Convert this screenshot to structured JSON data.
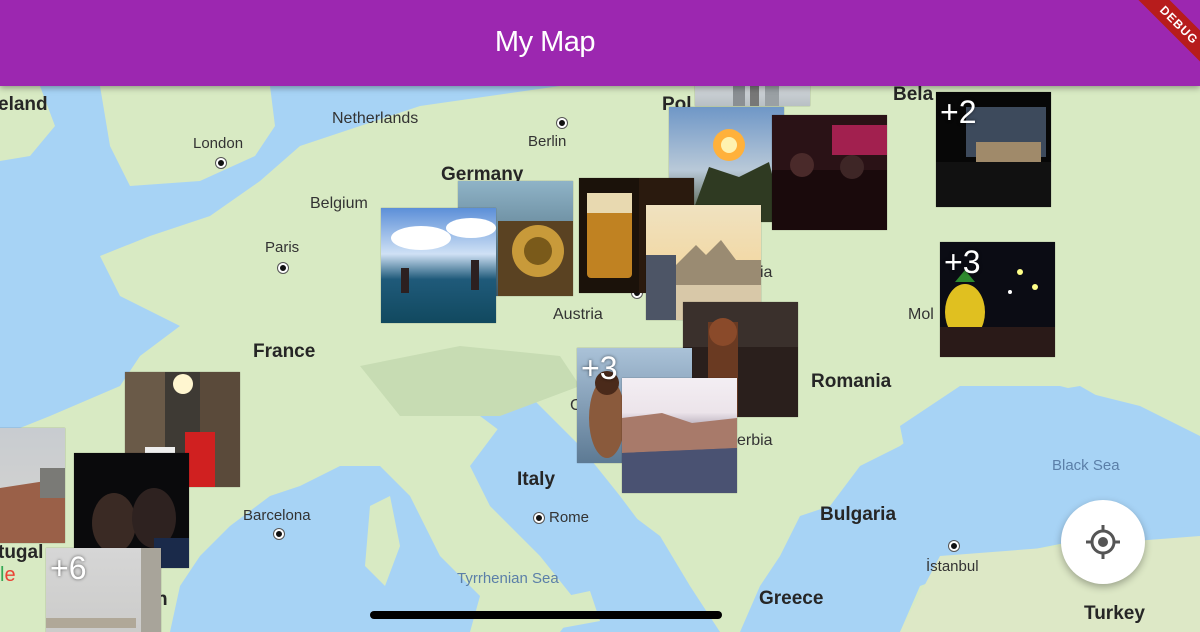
{
  "app": {
    "title": "My Map",
    "debug_banner": "DEBUG"
  },
  "map": {
    "countries": [
      "Ireland",
      "Netherlands",
      "Germany",
      "Belgium",
      "France",
      "Austria",
      "Poland",
      "Belarus",
      "Moldova",
      "Romania",
      "Serbia",
      "Italy",
      "Bulgaria",
      "Greece",
      "Turkey",
      "Portugal",
      "Croatia"
    ],
    "country_labels": {
      "ireland": "eland",
      "netherlands": "Netherlands",
      "germany": "Germany",
      "belgium": "Belgium",
      "france": "France",
      "austria": "Austria",
      "poland": "Pol",
      "belarus": "Bela",
      "moldova": "Mol",
      "romania": "Romania",
      "serbia": "erbia",
      "italy": "Italy",
      "bulgaria": "Bulgaria",
      "greece": "Greece",
      "turkey": "Turkey",
      "portugal": "tugal",
      "croatia": "C",
      "slovakia": "ia"
    },
    "city_labels": {
      "london": "London",
      "berlin": "Berlin",
      "paris": "Paris",
      "barcelona": "Barcelona",
      "rome": "Rome",
      "istanbul": "İstanbul",
      "spain_partial": "n"
    },
    "sea_labels": {
      "black_sea": "Black Sea",
      "tyrrhenian_sea": "Tyrrhenian Sea"
    },
    "attribution": "Google"
  },
  "photo_markers": [
    {
      "id": "budapest-top",
      "count": "",
      "scene": "city skyline"
    },
    {
      "id": "fire-torch",
      "count": "",
      "scene": "fire torch at dusk"
    },
    {
      "id": "bar-red",
      "count": "",
      "scene": "bar with red lights"
    },
    {
      "id": "stage-ukraine",
      "count": "+2",
      "scene": "theatre stage"
    },
    {
      "id": "beer-glass",
      "count": "",
      "scene": "beer glass"
    },
    {
      "id": "parliament",
      "count": "",
      "scene": "Budapest parliament"
    },
    {
      "id": "lake-jump",
      "count": "",
      "scene": "people jumping into lake"
    },
    {
      "id": "festival",
      "count": "+3",
      "scene": "festival lights"
    },
    {
      "id": "bottle-dark",
      "count": "",
      "scene": "dark room"
    },
    {
      "id": "croatia-girl",
      "count": "+3",
      "scene": "girl at the sea"
    },
    {
      "id": "dubrovnik",
      "count": "",
      "scene": "coastal city"
    },
    {
      "id": "spain-street",
      "count": "",
      "scene": "street party"
    },
    {
      "id": "portugal-city",
      "count": "",
      "scene": "rooftops"
    },
    {
      "id": "friends-night",
      "count": "",
      "scene": "friends at night"
    },
    {
      "id": "portugal-fog",
      "count": "+6",
      "scene": "foggy town"
    }
  ],
  "colors": {
    "appbar": "#9c27b0",
    "water": "#a7d3f5",
    "land": "#d8eac3",
    "debug": "#b71c1c"
  },
  "controls": {
    "locate_button_icon": "my-location-icon"
  }
}
